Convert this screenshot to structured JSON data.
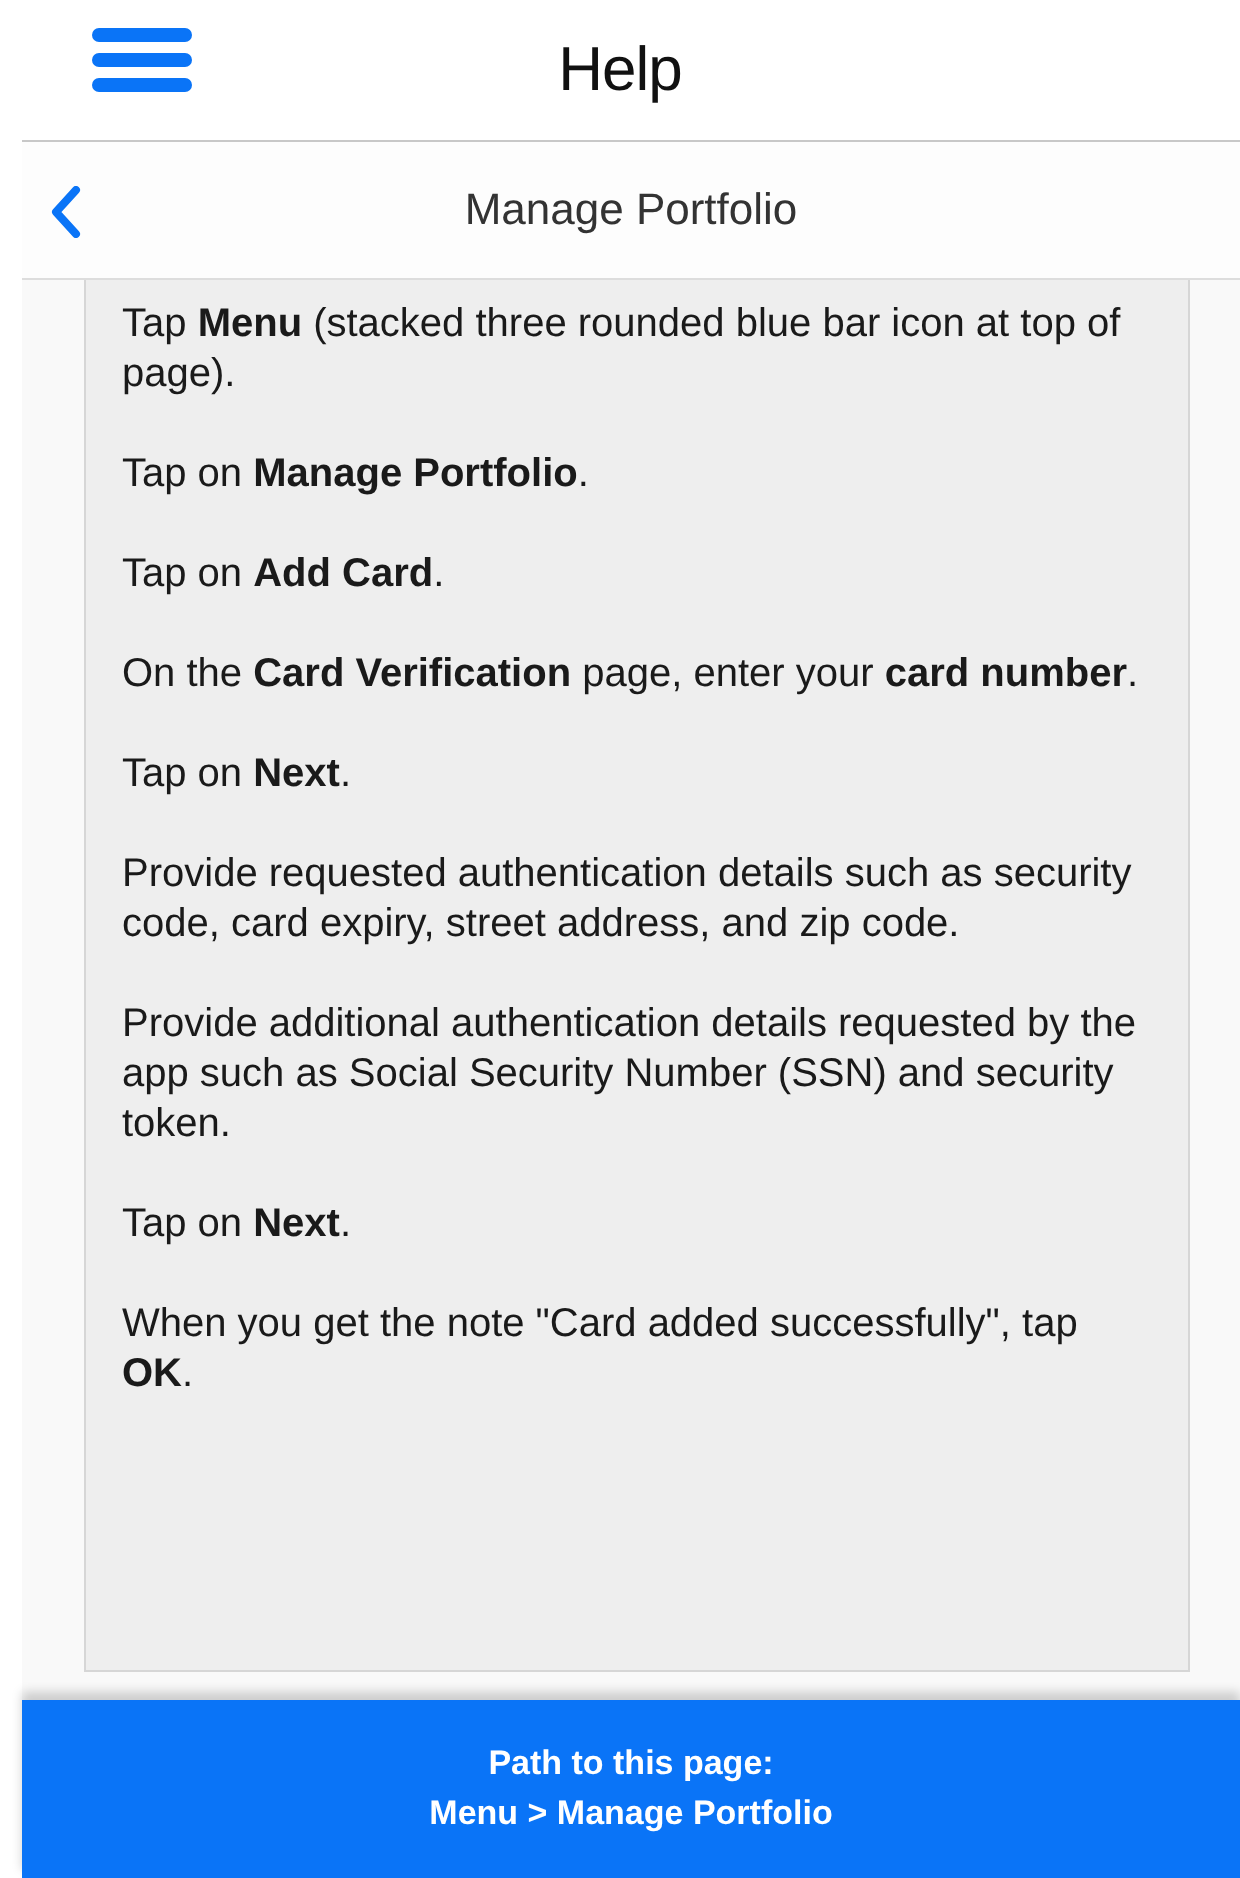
{
  "header": {
    "title": "Help"
  },
  "subheader": {
    "title": "Manage Portfolio"
  },
  "steps": [
    "Tap **Menu** (stacked three rounded blue bar icon at top of page).",
    "Tap on **Manage Portfolio**.",
    "Tap on **Add Card**.",
    "On the **Card Verification** page, enter your **card number**.",
    "Tap on **Next**.",
    "Provide requested authentication details such as security code, card expiry, street address, and zip code.",
    "Provide additional authentication details requested by the app such as Social Security Number (SSN) and security token.",
    "Tap on **Next**.",
    "When you get the note \"Card added successfully\", tap **OK**."
  ],
  "footer": {
    "label": "Path to this page:",
    "path": "Menu > Manage Portfolio"
  }
}
